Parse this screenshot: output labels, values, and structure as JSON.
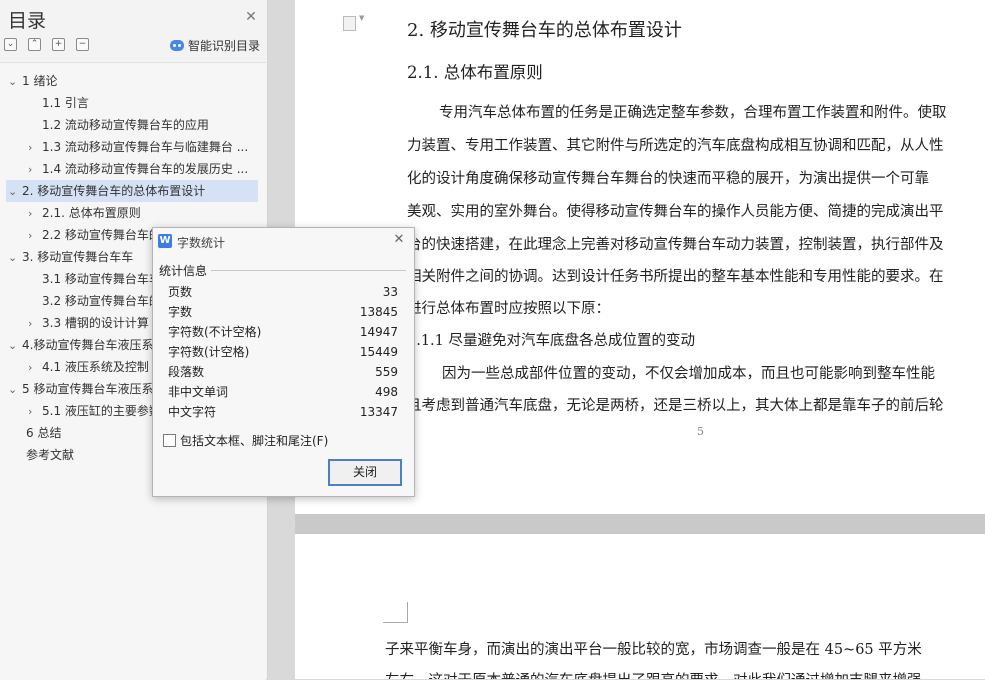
{
  "sidebar": {
    "title": "目录",
    "tools": [
      "⌄",
      "⌃",
      "+",
      "−"
    ],
    "smart_label": "智能识别目录",
    "items": [
      {
        "chev": "⌄",
        "label": "1  绪论"
      },
      {
        "chev": "",
        "label": "1.1  引言"
      },
      {
        "chev": "",
        "label": "1.2  流动移动宣传舞台车的应用"
      },
      {
        "chev": "›",
        "label": "1.3  流动移动宣传舞台车与临建舞台 ..."
      },
      {
        "chev": "›",
        "label": "1.4  流动移动宣传舞台车的发展历史 ..."
      },
      {
        "chev": "⌄",
        "label": "2.  移动宣传舞台车的总体布置设计"
      },
      {
        "chev": "›",
        "label": "2.1.  总体布置原则"
      },
      {
        "chev": "›",
        "label": "2.2  移动宣传舞台车的"
      },
      {
        "chev": "⌄",
        "label": "3.  移动宣传舞台车车"
      },
      {
        "chev": "",
        "label": "3.1  移动宣传舞台车车"
      },
      {
        "chev": "",
        "label": "3.2  移动宣传舞台车的"
      },
      {
        "chev": "›",
        "label": "3.3  槽钢的设计计算"
      },
      {
        "chev": "⌄",
        "label": "4.移动宣传舞台车液压系"
      },
      {
        "chev": "›",
        "label": "4.1  液压系统及控制"
      },
      {
        "chev": "⌄",
        "label": "5  移动宣传舞台车液压系"
      },
      {
        "chev": "›",
        "label": "5.1  液压缸的主要参数"
      },
      {
        "chev": "",
        "label": "6 总结"
      },
      {
        "chev": "",
        "label": "参考文献"
      }
    ]
  },
  "document": {
    "heading2": "2.  移动宣传舞台车的总体布置设计",
    "heading21": "2.1.  总体布置原则",
    "paragraph1": [
      "专用汽车总体布置的任务是正确选定整车参数，合理布置工作装置和附件。使取",
      "力装置、专用工作装置、其它附件与所选定的汽车底盘构成相互协调和匹配，从人性",
      "化的设计角度确保移动宣传舞台车舞台的快速而平稳的展开，为演出提供一个可靠",
      "美观、实用的室外舞台。使得移动宣传舞台车的操作人员能方便、简捷的完成演出平",
      "台的快速搭建，在此理念上完善对移动宣传舞台车动力装置，控制装置，执行部件及",
      "相关附件之间的协调。达到设计任务书所提出的整车基本性能和专用性能的要求。在",
      "进行总体布置时应按照以下原："
    ],
    "heading211": "2.1.1  尽量避免对汽车底盘各总成位置的变动",
    "paragraph2": [
      "因为一些总成部件位置的变动，不仅会增加成本，而且也可能影响到整车性能",
      "且考虑到普通汽车底盘，无论是两桥，还是三桥以上，其大体上都是靠车子的前后轮"
    ],
    "page_number": "5",
    "page2_lines": [
      "子来平衡车身，而演出的演出平台一般比较的宽，市场调查一般是在 45~65 平方米",
      "左右，这对于原本普通的汽车底盘提出了跟高的要求，对此我们通过增加支腿来增强"
    ]
  },
  "word_count_dialog": {
    "title": "字数统计",
    "group_label": "统计信息",
    "stats": [
      {
        "label": "页数",
        "value": "33"
      },
      {
        "label": "字数",
        "value": "13845"
      },
      {
        "label": "字符数(不计空格)",
        "value": "14947"
      },
      {
        "label": "字符数(计空格)",
        "value": "15449"
      },
      {
        "label": "段落数",
        "value": "559"
      },
      {
        "label": "非中文单词",
        "value": "498"
      },
      {
        "label": "中文字符",
        "value": "13347"
      }
    ],
    "checkbox_label": "包括文本框、脚注和尾注(F)",
    "checkbox_checked": false,
    "close_button": "关闭"
  },
  "colors": {
    "selected_toc_bg": "#d5e1f5",
    "accent": "#3d7be5"
  }
}
